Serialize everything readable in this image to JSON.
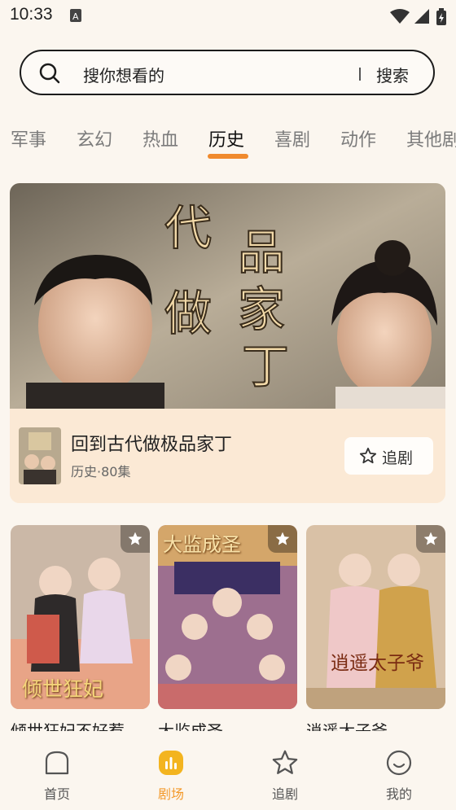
{
  "status_bar": {
    "time": "10:33"
  },
  "search": {
    "placeholder": "搜你想看的",
    "button_label": "搜索"
  },
  "category_tabs": [
    {
      "label": "军事"
    },
    {
      "label": "玄幻"
    },
    {
      "label": "热血"
    },
    {
      "label": "历史",
      "active": true
    },
    {
      "label": "喜剧"
    },
    {
      "label": "动作"
    },
    {
      "label": "其他剧"
    }
  ],
  "featured": {
    "banner_text": "回到古代做极品家丁",
    "title": "回到古代做极品家丁",
    "subtitle": "历史·80集",
    "follow_label": "追剧"
  },
  "cards": [
    {
      "title": "倾世狂妃不好惹",
      "poster_text": "倾世狂妃"
    },
    {
      "title": "大监成圣",
      "poster_text": "大监成圣"
    },
    {
      "title": "逍遥太子爷",
      "poster_text": "逍遥太子爷"
    }
  ],
  "bottom_nav": [
    {
      "label": "首页",
      "icon": "home-icon"
    },
    {
      "label": "剧场",
      "icon": "theater-icon",
      "active": true
    },
    {
      "label": "追剧",
      "icon": "star-icon"
    },
    {
      "label": "我的",
      "icon": "profile-icon"
    }
  ],
  "colors": {
    "accent": "#f08a2d",
    "background": "#fbf6ef",
    "card_bg": "#fbe9d5"
  }
}
